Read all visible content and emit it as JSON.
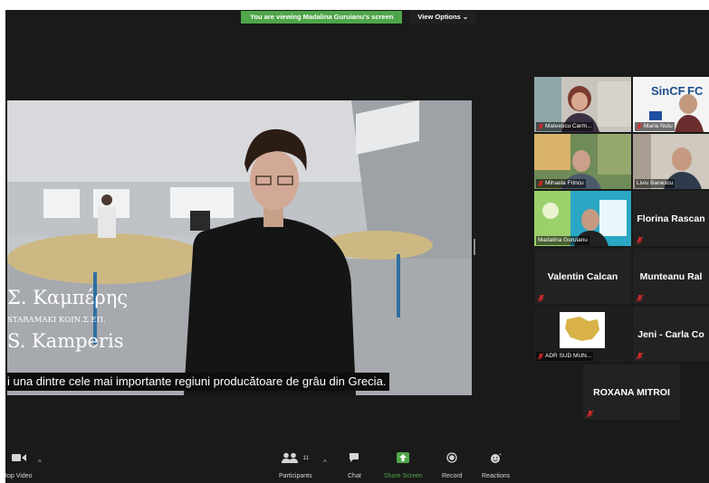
{
  "banner": {
    "message": "You are viewing Madalina Guruianu's screen",
    "view_options": "View Options ⌄"
  },
  "video": {
    "greek_name": "Σ. Καμπέρης",
    "org": "STARAMAKI ΚΟΙΝ.Σ.ΕΠ.",
    "latin_name": "S. Kamperis",
    "subtitle": "i una dintre cele mai importante regiuni producătoare de grâu din Grecia."
  },
  "participants": [
    {
      "name": "Mateescu Carm...",
      "muted": true
    },
    {
      "name": "Maria Nutu",
      "muted": true
    },
    {
      "name": "Mihaela Frincu",
      "muted": true
    },
    {
      "name": "Liviu Banescu",
      "muted": false
    },
    {
      "name": "Madalina Guruianu",
      "muted": false
    },
    {
      "name": "Florina Rascan",
      "muted": true
    },
    {
      "name": "Valentin Calcan",
      "muted": true
    },
    {
      "name": "Munteanu Ral",
      "muted": true
    },
    {
      "name": "ADR SUD MUN...",
      "muted": true
    },
    {
      "name": "Jeni - Carla Co",
      "muted": true
    },
    {
      "name": "ROXANA MITROI",
      "muted": true
    }
  ],
  "toolbar": {
    "stop_video": "top Video",
    "participants": "Participants",
    "participants_count": "11",
    "chat": "Chat",
    "share_screen": "Share Screen",
    "record": "Record",
    "reactions": "Reactions"
  },
  "colors": {
    "share_green": "#4fa64a",
    "active_speaker": "#e6c84a",
    "muted_red": "#e02828"
  }
}
